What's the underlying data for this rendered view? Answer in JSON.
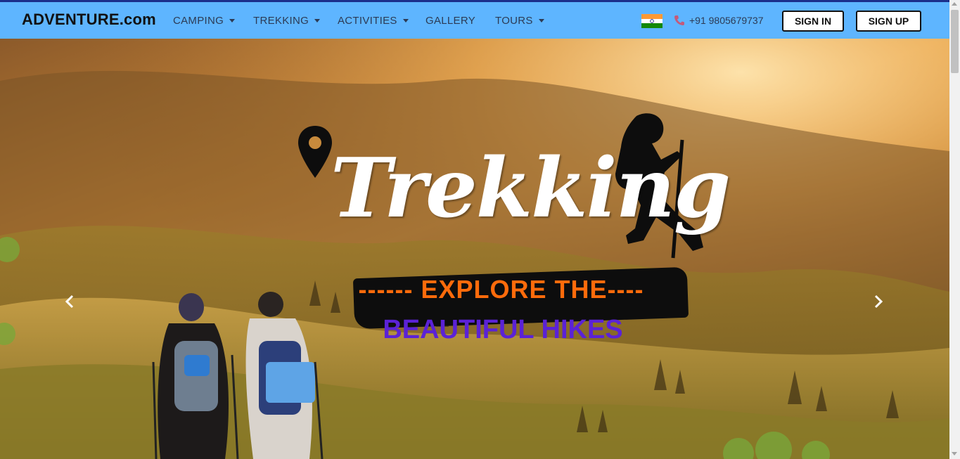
{
  "navbar": {
    "brand": "ADVENTURE.com",
    "items": [
      {
        "label": "CAMPING",
        "dropdown": true
      },
      {
        "label": "TREKKING",
        "dropdown": true
      },
      {
        "label": "ACTIVITIES",
        "dropdown": true
      },
      {
        "label": "GALLERY",
        "dropdown": false
      },
      {
        "label": "TOURS",
        "dropdown": true
      }
    ],
    "phone": "+91 9805679737",
    "sign_in": "SIGN IN",
    "sign_up": "SIGN UP",
    "flag_icon": "india-flag-icon",
    "phone_icon": "phone-icon"
  },
  "hero": {
    "title": "Trekking",
    "line1": "------ EXPLORE  THE----",
    "line2": "BEAUTIFUL HIKES",
    "prev_icon": "chevron-left-icon",
    "next_icon": "chevron-right-icon"
  },
  "colors": {
    "navbar_bg": "#5eb5ff",
    "explore_text": "#ff6b0b",
    "hikes_text": "#5b22d6"
  }
}
